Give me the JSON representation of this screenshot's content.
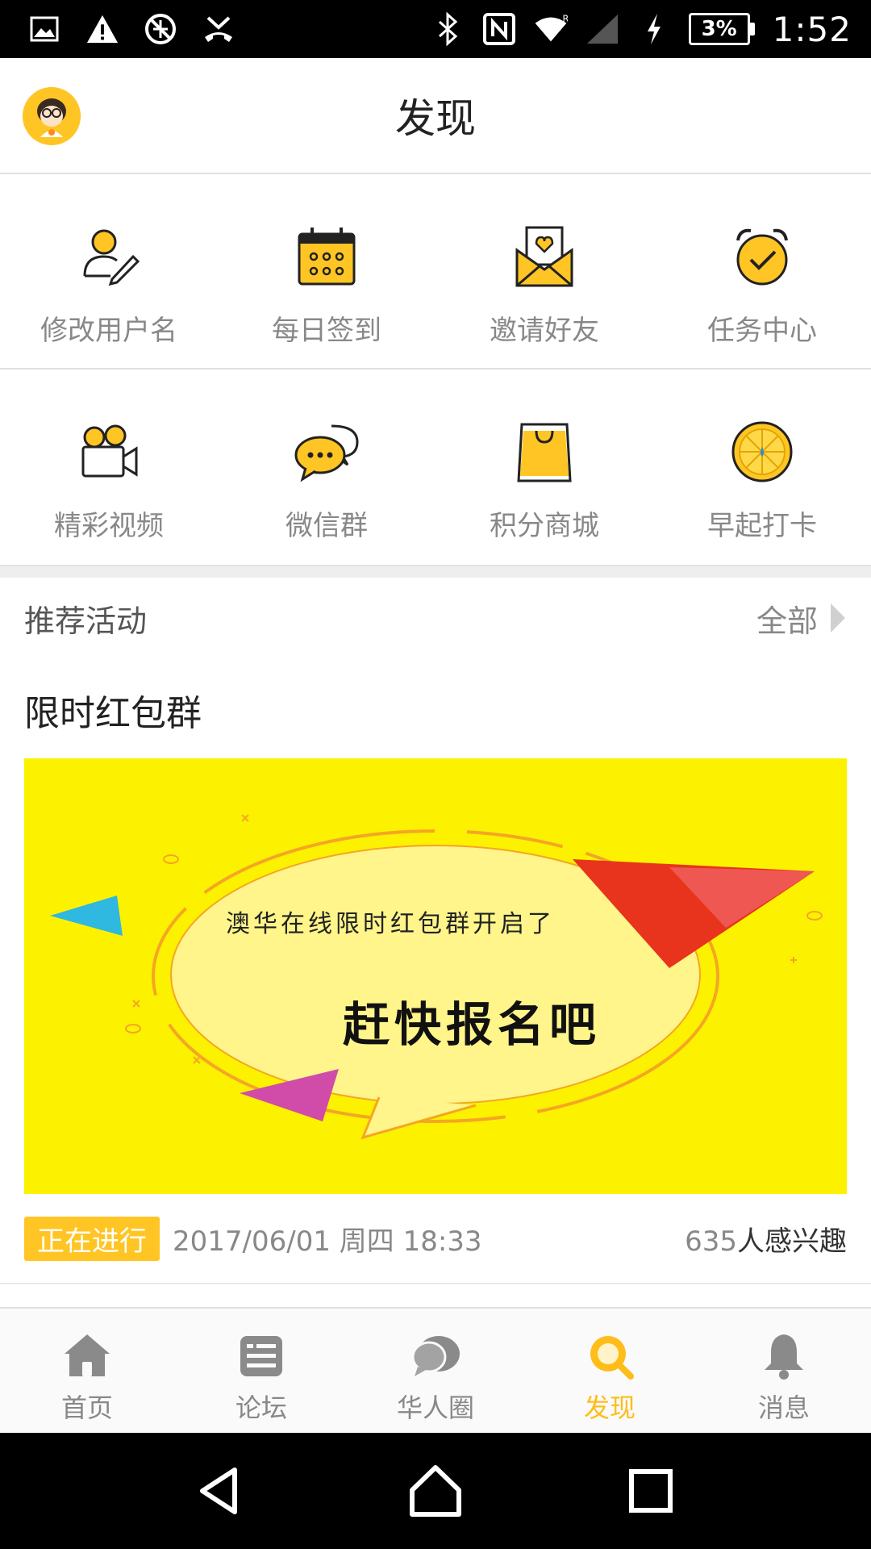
{
  "status_bar": {
    "battery": "3%",
    "time": "1:52",
    "signal_roaming": "R"
  },
  "header": {
    "title": "发现"
  },
  "grid_row1": [
    {
      "label": "修改用户名",
      "icon": "edit-user-icon"
    },
    {
      "label": "每日签到",
      "icon": "calendar-icon"
    },
    {
      "label": "邀请好友",
      "icon": "invite-envelope-icon"
    },
    {
      "label": "任务中心",
      "icon": "alarm-check-icon"
    }
  ],
  "grid_row2": [
    {
      "label": "精彩视频",
      "icon": "video-camera-icon"
    },
    {
      "label": "微信群",
      "icon": "chat-bubbles-icon"
    },
    {
      "label": "积分商城",
      "icon": "shopping-bag-icon"
    },
    {
      "label": "早起打卡",
      "icon": "orange-slice-icon"
    }
  ],
  "section": {
    "title": "推荐活动",
    "more_label": "全部"
  },
  "activity": {
    "title": "限时红包群",
    "banner_line1": "澳华在线限时红包群开启了",
    "banner_line2": "赶快报名吧",
    "status": "正在进行",
    "datetime": "2017/06/01 周四 18:33",
    "interest_count": "635",
    "interest_label": "人感兴趣"
  },
  "bottom_nav": [
    {
      "label": "首页",
      "icon": "home-icon",
      "active": false
    },
    {
      "label": "论坛",
      "icon": "forum-icon",
      "active": false
    },
    {
      "label": "华人圈",
      "icon": "circle-chat-icon",
      "active": false
    },
    {
      "label": "发现",
      "icon": "discover-search-icon",
      "active": true
    },
    {
      "label": "消息",
      "icon": "bell-icon",
      "active": false
    }
  ],
  "colors": {
    "accent": "#ffc524",
    "active_tab": "#ffbd1a",
    "banner_bg": "#fcf200",
    "muted_text": "#888888"
  }
}
